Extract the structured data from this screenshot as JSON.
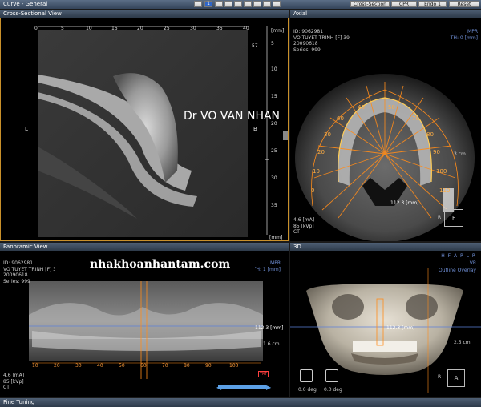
{
  "app": {
    "window_title": "Curve - General",
    "page_number": "1",
    "buttons": [
      "Cross-Section",
      "CPR",
      "Endo 1",
      "Reset"
    ]
  },
  "cross_section": {
    "header": "Cross-Sectional View",
    "top_ticks": [
      "0",
      "5",
      "10",
      "15",
      "20",
      "25",
      "30",
      "35",
      "40"
    ],
    "unit_top": "[mm]",
    "right_ticks": [
      "5",
      "10",
      "15",
      "20",
      "25",
      "30",
      "35"
    ],
    "unit_bottom": "[mm]",
    "slice_no": "57",
    "label_left": "L",
    "label_right": "B",
    "watermark": "Dr VO VAN NHAN"
  },
  "axial": {
    "header": "Axial",
    "info": [
      "ID: 9062981",
      "VO TUYET TRINH [F] 39",
      "20090618",
      "Series: 999"
    ],
    "mpr_label": "MPR",
    "th_label": "TH: 0 [mm]",
    "scale_label": "3 cm",
    "measure": "112.3 [mm]",
    "ma": "4.6 [mA]",
    "kvp": "85 [kVp]",
    "modality": "CT",
    "orient": "R",
    "orient_box": "F",
    "section_numbers": [
      "40",
      "50",
      "60",
      "70",
      "30",
      "80",
      "20",
      "90",
      "10",
      "100",
      "0",
      "110"
    ]
  },
  "panoramic": {
    "header": "Panoramic View",
    "info": [
      "ID: 9062981",
      "VO TUYET TRINH [F] 39",
      "20090618",
      "Series: 999"
    ],
    "mpr_label": "MPR",
    "th_label": "TH: 1 [mm]",
    "watermark": "nhakhoanhantam.com",
    "measure": "112.3 [mm]",
    "scale_label": "1.6 cm",
    "ma": "4.6 [mA]",
    "kvp": "85 [kVp]",
    "modality": "CT",
    "ticks": [
      "10",
      "20",
      "30",
      "40",
      "50",
      "60",
      "70",
      "80",
      "90",
      "100"
    ],
    "trt": "TRT"
  },
  "three_d": {
    "header": "3D",
    "orient_letters": "H F A P L R",
    "vr_label": "VR",
    "outline_label": "Outline Overlay",
    "measure": "112.3 [mm]",
    "scale_label": "2.5 cm",
    "orient": "R",
    "orient_box": "A",
    "deg1": "0.0 deg",
    "deg2": "0.0 deg"
  },
  "footer": {
    "label": "Fine Tuning"
  }
}
